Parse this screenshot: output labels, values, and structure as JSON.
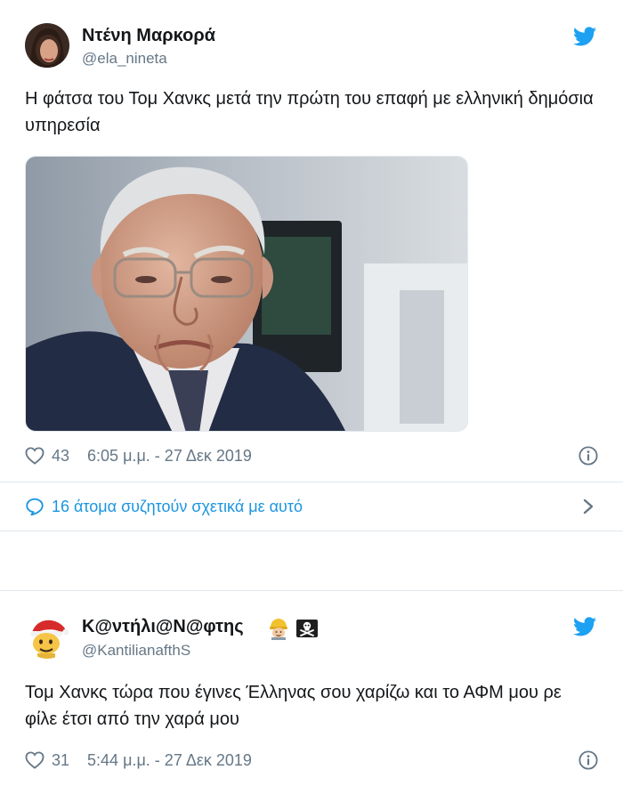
{
  "tweets": [
    {
      "author_name": "Ντένη Μαρκορά",
      "author_handle": "@ela_nineta",
      "text": "Η φάτσα του Τομ Χανκς μετά την πρώτη του επαφή με ελληνική δημόσια υπηρεσία",
      "likes": "43",
      "timestamp": "6:05 μ.μ. - 27 Δεκ 2019",
      "conversation": "16 άτομα συζητούν σχετικά με αυτό"
    },
    {
      "author_name": "Κ@ντήλι@Ν@φτης",
      "author_handle": "@KantilianafthS",
      "text": "Τομ Χανκς τώρα που έγινες Έλληνας σου χαρίζω και το ΑΦΜ μου ρε φίλε έτσι από την χαρά μου",
      "likes": "31",
      "timestamp": "5:44 μ.μ. - 27 Δεκ 2019"
    }
  ],
  "icons": {
    "brand": "twitter-bird-icon",
    "like": "heart-icon",
    "info": "info-icon",
    "conversation": "speech-bubble-icon",
    "chevron": "chevron-right-icon",
    "name_emojis": [
      "construction-worker-icon",
      "pirate-flag-icon"
    ]
  },
  "colors": {
    "accent": "#1da1f2",
    "link": "#1b95e0",
    "secondary_text": "#657786",
    "primary_text": "#14171a",
    "border": "#e1e8ed"
  }
}
